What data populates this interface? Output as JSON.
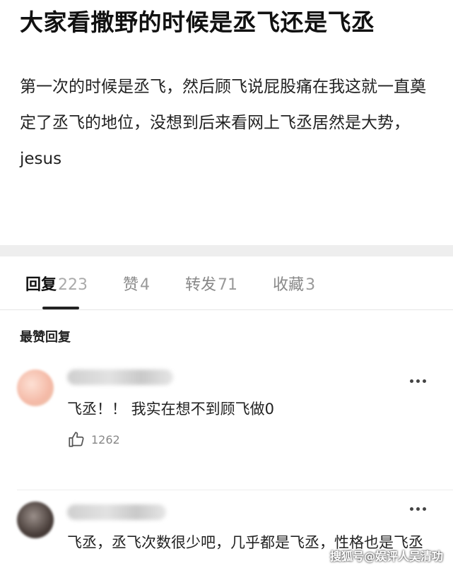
{
  "post": {
    "title": "大家看撒野的时候是丞飞还是飞丞",
    "body": "第一次的时候是丞飞，然后顾飞说屁股痛在我这就一直奠定了丞飞的地位，没想到后来看网上飞丞居然是大势，jesus"
  },
  "tabs": [
    {
      "label": "回复",
      "count": "223",
      "active": true
    },
    {
      "label": "赞",
      "count": "4",
      "active": false
    },
    {
      "label": "转发",
      "count": "71",
      "active": false
    },
    {
      "label": "收藏",
      "count": "3",
      "active": false
    }
  ],
  "section_heading": "最赞回复",
  "comments": [
    {
      "text": "飞丞！！ 我实在想不到顾飞做0",
      "likes": "1262"
    },
    {
      "text": "飞丞，丞飞次数很少吧，几乎都是飞丞，性格也是飞丞"
    }
  ],
  "icons": {
    "more": "more-dots-icon",
    "like": "thumbs-up-icon"
  },
  "watermark": "搜狐号@娱评人吴清功"
}
